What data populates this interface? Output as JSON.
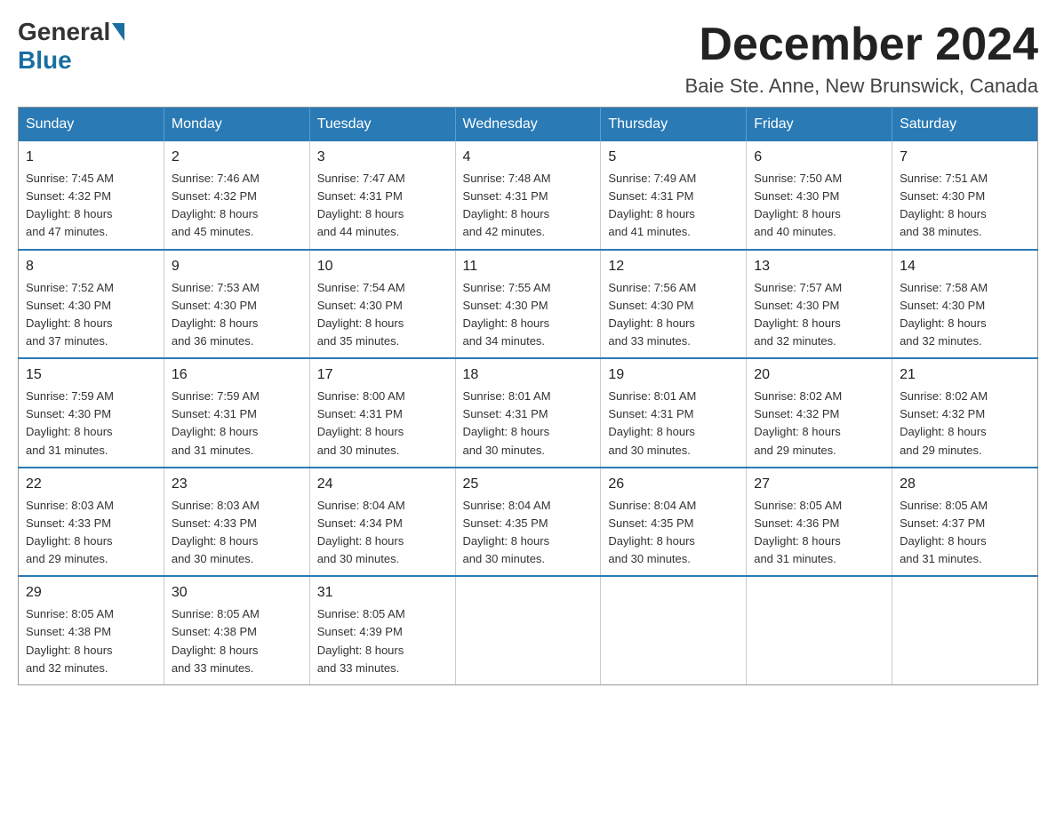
{
  "header": {
    "logo_general": "General",
    "logo_blue": "Blue",
    "month_title": "December 2024",
    "location": "Baie Ste. Anne, New Brunswick, Canada"
  },
  "weekdays": [
    "Sunday",
    "Monday",
    "Tuesday",
    "Wednesday",
    "Thursday",
    "Friday",
    "Saturday"
  ],
  "weeks": [
    [
      {
        "day": "1",
        "sunrise": "7:45 AM",
        "sunset": "4:32 PM",
        "daylight": "8 hours and 47 minutes."
      },
      {
        "day": "2",
        "sunrise": "7:46 AM",
        "sunset": "4:32 PM",
        "daylight": "8 hours and 45 minutes."
      },
      {
        "day": "3",
        "sunrise": "7:47 AM",
        "sunset": "4:31 PM",
        "daylight": "8 hours and 44 minutes."
      },
      {
        "day": "4",
        "sunrise": "7:48 AM",
        "sunset": "4:31 PM",
        "daylight": "8 hours and 42 minutes."
      },
      {
        "day": "5",
        "sunrise": "7:49 AM",
        "sunset": "4:31 PM",
        "daylight": "8 hours and 41 minutes."
      },
      {
        "day": "6",
        "sunrise": "7:50 AM",
        "sunset": "4:30 PM",
        "daylight": "8 hours and 40 minutes."
      },
      {
        "day": "7",
        "sunrise": "7:51 AM",
        "sunset": "4:30 PM",
        "daylight": "8 hours and 38 minutes."
      }
    ],
    [
      {
        "day": "8",
        "sunrise": "7:52 AM",
        "sunset": "4:30 PM",
        "daylight": "8 hours and 37 minutes."
      },
      {
        "day": "9",
        "sunrise": "7:53 AM",
        "sunset": "4:30 PM",
        "daylight": "8 hours and 36 minutes."
      },
      {
        "day": "10",
        "sunrise": "7:54 AM",
        "sunset": "4:30 PM",
        "daylight": "8 hours and 35 minutes."
      },
      {
        "day": "11",
        "sunrise": "7:55 AM",
        "sunset": "4:30 PM",
        "daylight": "8 hours and 34 minutes."
      },
      {
        "day": "12",
        "sunrise": "7:56 AM",
        "sunset": "4:30 PM",
        "daylight": "8 hours and 33 minutes."
      },
      {
        "day": "13",
        "sunrise": "7:57 AM",
        "sunset": "4:30 PM",
        "daylight": "8 hours and 32 minutes."
      },
      {
        "day": "14",
        "sunrise": "7:58 AM",
        "sunset": "4:30 PM",
        "daylight": "8 hours and 32 minutes."
      }
    ],
    [
      {
        "day": "15",
        "sunrise": "7:59 AM",
        "sunset": "4:30 PM",
        "daylight": "8 hours and 31 minutes."
      },
      {
        "day": "16",
        "sunrise": "7:59 AM",
        "sunset": "4:31 PM",
        "daylight": "8 hours and 31 minutes."
      },
      {
        "day": "17",
        "sunrise": "8:00 AM",
        "sunset": "4:31 PM",
        "daylight": "8 hours and 30 minutes."
      },
      {
        "day": "18",
        "sunrise": "8:01 AM",
        "sunset": "4:31 PM",
        "daylight": "8 hours and 30 minutes."
      },
      {
        "day": "19",
        "sunrise": "8:01 AM",
        "sunset": "4:31 PM",
        "daylight": "8 hours and 30 minutes."
      },
      {
        "day": "20",
        "sunrise": "8:02 AM",
        "sunset": "4:32 PM",
        "daylight": "8 hours and 29 minutes."
      },
      {
        "day": "21",
        "sunrise": "8:02 AM",
        "sunset": "4:32 PM",
        "daylight": "8 hours and 29 minutes."
      }
    ],
    [
      {
        "day": "22",
        "sunrise": "8:03 AM",
        "sunset": "4:33 PM",
        "daylight": "8 hours and 29 minutes."
      },
      {
        "day": "23",
        "sunrise": "8:03 AM",
        "sunset": "4:33 PM",
        "daylight": "8 hours and 30 minutes."
      },
      {
        "day": "24",
        "sunrise": "8:04 AM",
        "sunset": "4:34 PM",
        "daylight": "8 hours and 30 minutes."
      },
      {
        "day": "25",
        "sunrise": "8:04 AM",
        "sunset": "4:35 PM",
        "daylight": "8 hours and 30 minutes."
      },
      {
        "day": "26",
        "sunrise": "8:04 AM",
        "sunset": "4:35 PM",
        "daylight": "8 hours and 30 minutes."
      },
      {
        "day": "27",
        "sunrise": "8:05 AM",
        "sunset": "4:36 PM",
        "daylight": "8 hours and 31 minutes."
      },
      {
        "day": "28",
        "sunrise": "8:05 AM",
        "sunset": "4:37 PM",
        "daylight": "8 hours and 31 minutes."
      }
    ],
    [
      {
        "day": "29",
        "sunrise": "8:05 AM",
        "sunset": "4:38 PM",
        "daylight": "8 hours and 32 minutes."
      },
      {
        "day": "30",
        "sunrise": "8:05 AM",
        "sunset": "4:38 PM",
        "daylight": "8 hours and 33 minutes."
      },
      {
        "day": "31",
        "sunrise": "8:05 AM",
        "sunset": "4:39 PM",
        "daylight": "8 hours and 33 minutes."
      },
      null,
      null,
      null,
      null
    ]
  ],
  "labels": {
    "sunrise": "Sunrise:",
    "sunset": "Sunset:",
    "daylight": "Daylight:"
  }
}
